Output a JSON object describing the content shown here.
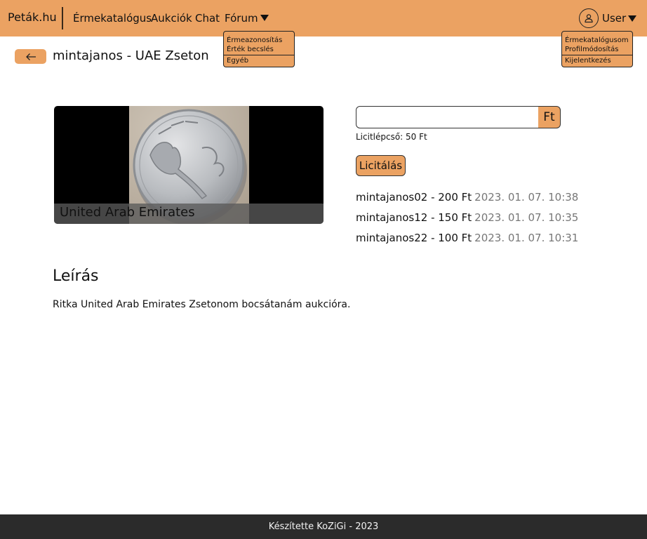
{
  "navbar": {
    "brand": "Peták.hu",
    "links": [
      "Érmekatalógus",
      "Aukciók",
      "Chat"
    ],
    "forum_label": "Fórum",
    "user_label": "User"
  },
  "forum_menu": {
    "items": [
      "Érmeazonosítás",
      "Érték becslés",
      "Egyéb"
    ]
  },
  "user_menu": {
    "items": [
      "Érmekatalógusom",
      "Profilmódosítás",
      "Kijelentkezés"
    ]
  },
  "page": {
    "title": "mintajanos - UAE Zseton",
    "back_icon": "arrow-left-icon"
  },
  "coin": {
    "caption": "United Arab Emirates"
  },
  "bid_form": {
    "input_value": "",
    "currency": "Ft",
    "step_text": "Licitlépcső: 50 Ft",
    "submit_label": "Licitálás"
  },
  "bids": [
    {
      "text": "mintajanos02 - 200 Ft",
      "time": "2023. 01. 07. 10:38"
    },
    {
      "text": "mintajanos12 - 150 Ft",
      "time": "2023. 01. 07. 10:35"
    },
    {
      "text": "mintajanos22 - 100 Ft",
      "time": "2023. 01. 07. 10:31"
    }
  ],
  "description": {
    "heading": "Leírás",
    "text": "Ritka United Arab Emirates Zsetonom bocsátanám aukcióra."
  },
  "footer": {
    "text": "Készítette KoZiGi - 2023"
  },
  "colors": {
    "accent": "#eba262",
    "footer_bg": "#2b2b2b",
    "muted_text": "#777777"
  }
}
